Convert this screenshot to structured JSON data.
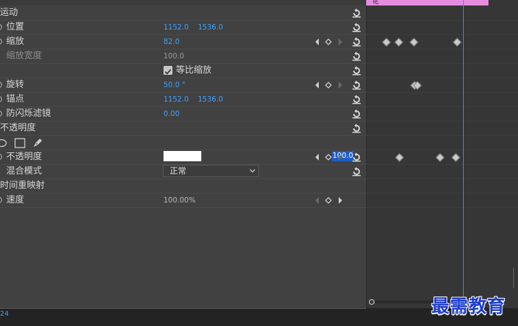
{
  "effects": {
    "motion": "运动",
    "position": {
      "label": "位置",
      "x": "1152.0",
      "y": "1536.0"
    },
    "scale": {
      "label": "缩放",
      "value": "82.0"
    },
    "scale_width": {
      "label": "缩放宽度",
      "value": "100.0"
    },
    "uniform_scale": {
      "label": "等比缩放"
    },
    "rotation": {
      "label": "旋转",
      "value": "50.0 °"
    },
    "anchor": {
      "label": "锚点",
      "x": "1152.0",
      "y": "1536.0"
    },
    "anti_flicker": {
      "label": "防闪烁滤镜",
      "value": "0.00"
    },
    "opacity_section": "不透明度",
    "opacity": {
      "label": "不透明度",
      "value": "100.0"
    },
    "blend": {
      "label": "混合模式",
      "value": "正常"
    },
    "time_remap": "时间重映射",
    "speed": {
      "label": "速度",
      "value": "100.00%"
    }
  },
  "timeline": {
    "clip_name": "花",
    "playhead_fraction": 0.639
  },
  "timecode": "24",
  "watermark": "最需教育",
  "colors": {
    "value_blue": "#3ea0ff",
    "panel_bg": "#414141",
    "clip_pink": "#e68ce0",
    "playhead_blue": "#3a8cff"
  }
}
